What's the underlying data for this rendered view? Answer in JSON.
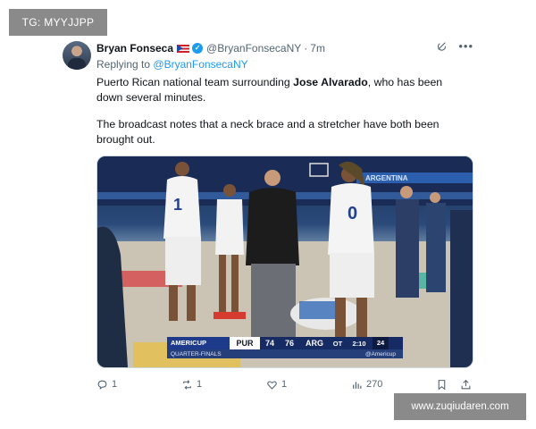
{
  "overlay": {
    "top_left_tag": "TG: MYYJJPP",
    "bottom_right_watermark": "www.zuqiudaren.com"
  },
  "tweet": {
    "author_name": "Bryan Fonseca",
    "handle": "@BryanFonsecaNY",
    "time": "7m",
    "replying_label": "Replying to",
    "replying_to": "@BryanFonsecaNY",
    "text_p1_before": "Puerto Rican national team surrounding ",
    "text_p1_bold": "Jose Alvarado",
    "text_p1_after": ", who has been down several minutes.",
    "text_p2": "The broadcast notes that a neck brace and a stretcher have both been brought out.",
    "icons": [
      "puerto-rico-flag-icon",
      "verified-badge-icon",
      "grok-icon",
      "more-icon"
    ]
  },
  "media": {
    "jersey_numbers": [
      "1",
      "0"
    ],
    "court_banner": "ARGENTINA",
    "scorebug": {
      "competition": "AMERICUP",
      "round": "QUARTER-FINALS",
      "team1": "PUR",
      "score1": "74",
      "score2": "76",
      "team2": "ARG",
      "period": "OT",
      "clock": "2:10",
      "shot_clock": "24",
      "source": "@Americup"
    }
  },
  "actions": {
    "replies": "1",
    "reposts": "1",
    "likes": "1",
    "views": "270",
    "icons": [
      "reply-icon",
      "repost-icon",
      "like-icon",
      "views-icon",
      "bookmark-icon",
      "share-icon"
    ]
  },
  "colors": {
    "link": "#1d9bf0",
    "secondary_text": "#536471",
    "overlay_gray": "#8a8a8a"
  }
}
